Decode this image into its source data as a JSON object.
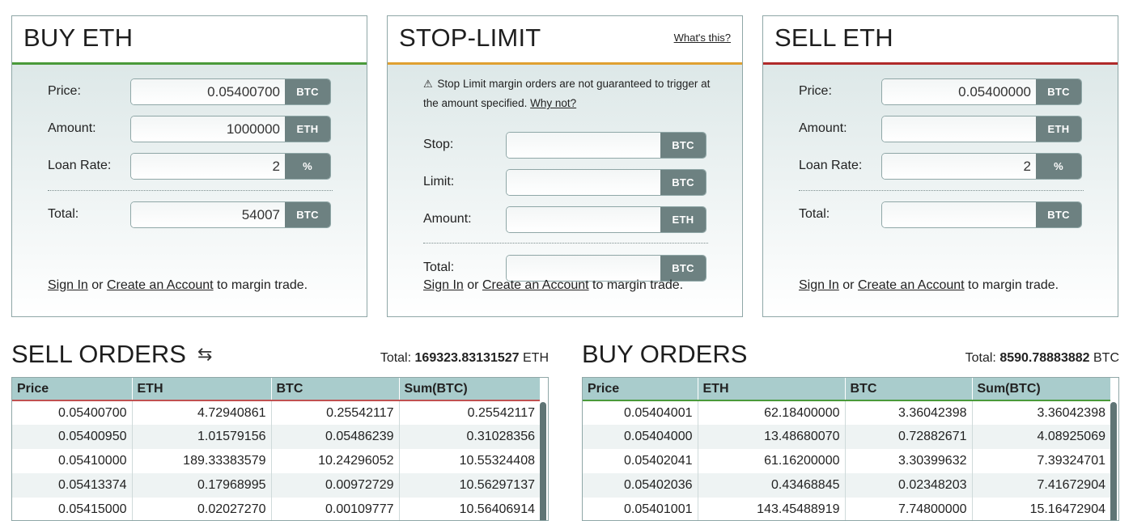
{
  "buy_panel": {
    "title": "BUY ETH",
    "accent": "#4a9a3a",
    "price": {
      "label": "Price:",
      "value": "0.05400700",
      "unit": "BTC"
    },
    "amount": {
      "label": "Amount:",
      "value": "1000000",
      "unit": "ETH"
    },
    "loan_rate": {
      "label": "Loan Rate:",
      "value": "2",
      "unit": "%"
    },
    "total": {
      "label": "Total:",
      "value": "54007",
      "unit": "BTC"
    },
    "signin": {
      "sign_in": "Sign In",
      "or": "or",
      "create": "Create an Account",
      "suffix": "to margin trade."
    }
  },
  "stop_panel": {
    "title": "STOP-LIMIT",
    "accent": "#e0a030",
    "link": "What's this?",
    "warning": "Stop Limit margin orders are not guaranteed to trigger at the amount specified.",
    "why_not": "Why not?",
    "stop": {
      "label": "Stop:",
      "value": "",
      "unit": "BTC"
    },
    "limit": {
      "label": "Limit:",
      "value": "",
      "unit": "BTC"
    },
    "amount": {
      "label": "Amount:",
      "value": "",
      "unit": "ETH"
    },
    "total": {
      "label": "Total:",
      "value": "",
      "unit": "BTC"
    },
    "signin": {
      "sign_in": "Sign In",
      "or": "or",
      "create": "Create an Account",
      "suffix": "to margin trade."
    }
  },
  "sell_panel": {
    "title": "SELL ETH",
    "accent": "#b02a2a",
    "price": {
      "label": "Price:",
      "value": "0.05400000",
      "unit": "BTC"
    },
    "amount": {
      "label": "Amount:",
      "value": "",
      "unit": "ETH"
    },
    "loan_rate": {
      "label": "Loan Rate:",
      "value": "2",
      "unit": "%"
    },
    "total": {
      "label": "Total:",
      "value": "",
      "unit": "BTC"
    },
    "signin": {
      "sign_in": "Sign In",
      "or": "or",
      "create": "Create an Account",
      "suffix": "to margin trade."
    }
  },
  "sell_orders": {
    "title": "SELL ORDERS",
    "total_label": "Total:",
    "total_value": "169323.83131527",
    "total_unit": "ETH",
    "columns": [
      "Price",
      "ETH",
      "BTC",
      "Sum(BTC)"
    ],
    "rows": [
      [
        "0.05400700",
        "4.72940861",
        "0.25542117",
        "0.25542117"
      ],
      [
        "0.05400950",
        "1.01579156",
        "0.05486239",
        "0.31028356"
      ],
      [
        "0.05410000",
        "189.33383579",
        "10.24296052",
        "10.55324408"
      ],
      [
        "0.05413374",
        "0.17968995",
        "0.00972729",
        "10.56297137"
      ],
      [
        "0.05415000",
        "0.02027270",
        "0.00109777",
        "10.56406914"
      ]
    ]
  },
  "buy_orders": {
    "title": "BUY ORDERS",
    "total_label": "Total:",
    "total_value": "8590.78883882",
    "total_unit": "BTC",
    "columns": [
      "Price",
      "ETH",
      "BTC",
      "Sum(BTC)"
    ],
    "rows": [
      [
        "0.05404001",
        "62.18400000",
        "3.36042398",
        "3.36042398"
      ],
      [
        "0.05404000",
        "13.48680070",
        "0.72882671",
        "4.08925069"
      ],
      [
        "0.05402041",
        "61.16200000",
        "3.30399632",
        "7.39324701"
      ],
      [
        "0.05402036",
        "0.43468845",
        "0.02348203",
        "7.41672904"
      ],
      [
        "0.05401001",
        "143.45488919",
        "7.74800000",
        "15.16472904"
      ]
    ]
  }
}
